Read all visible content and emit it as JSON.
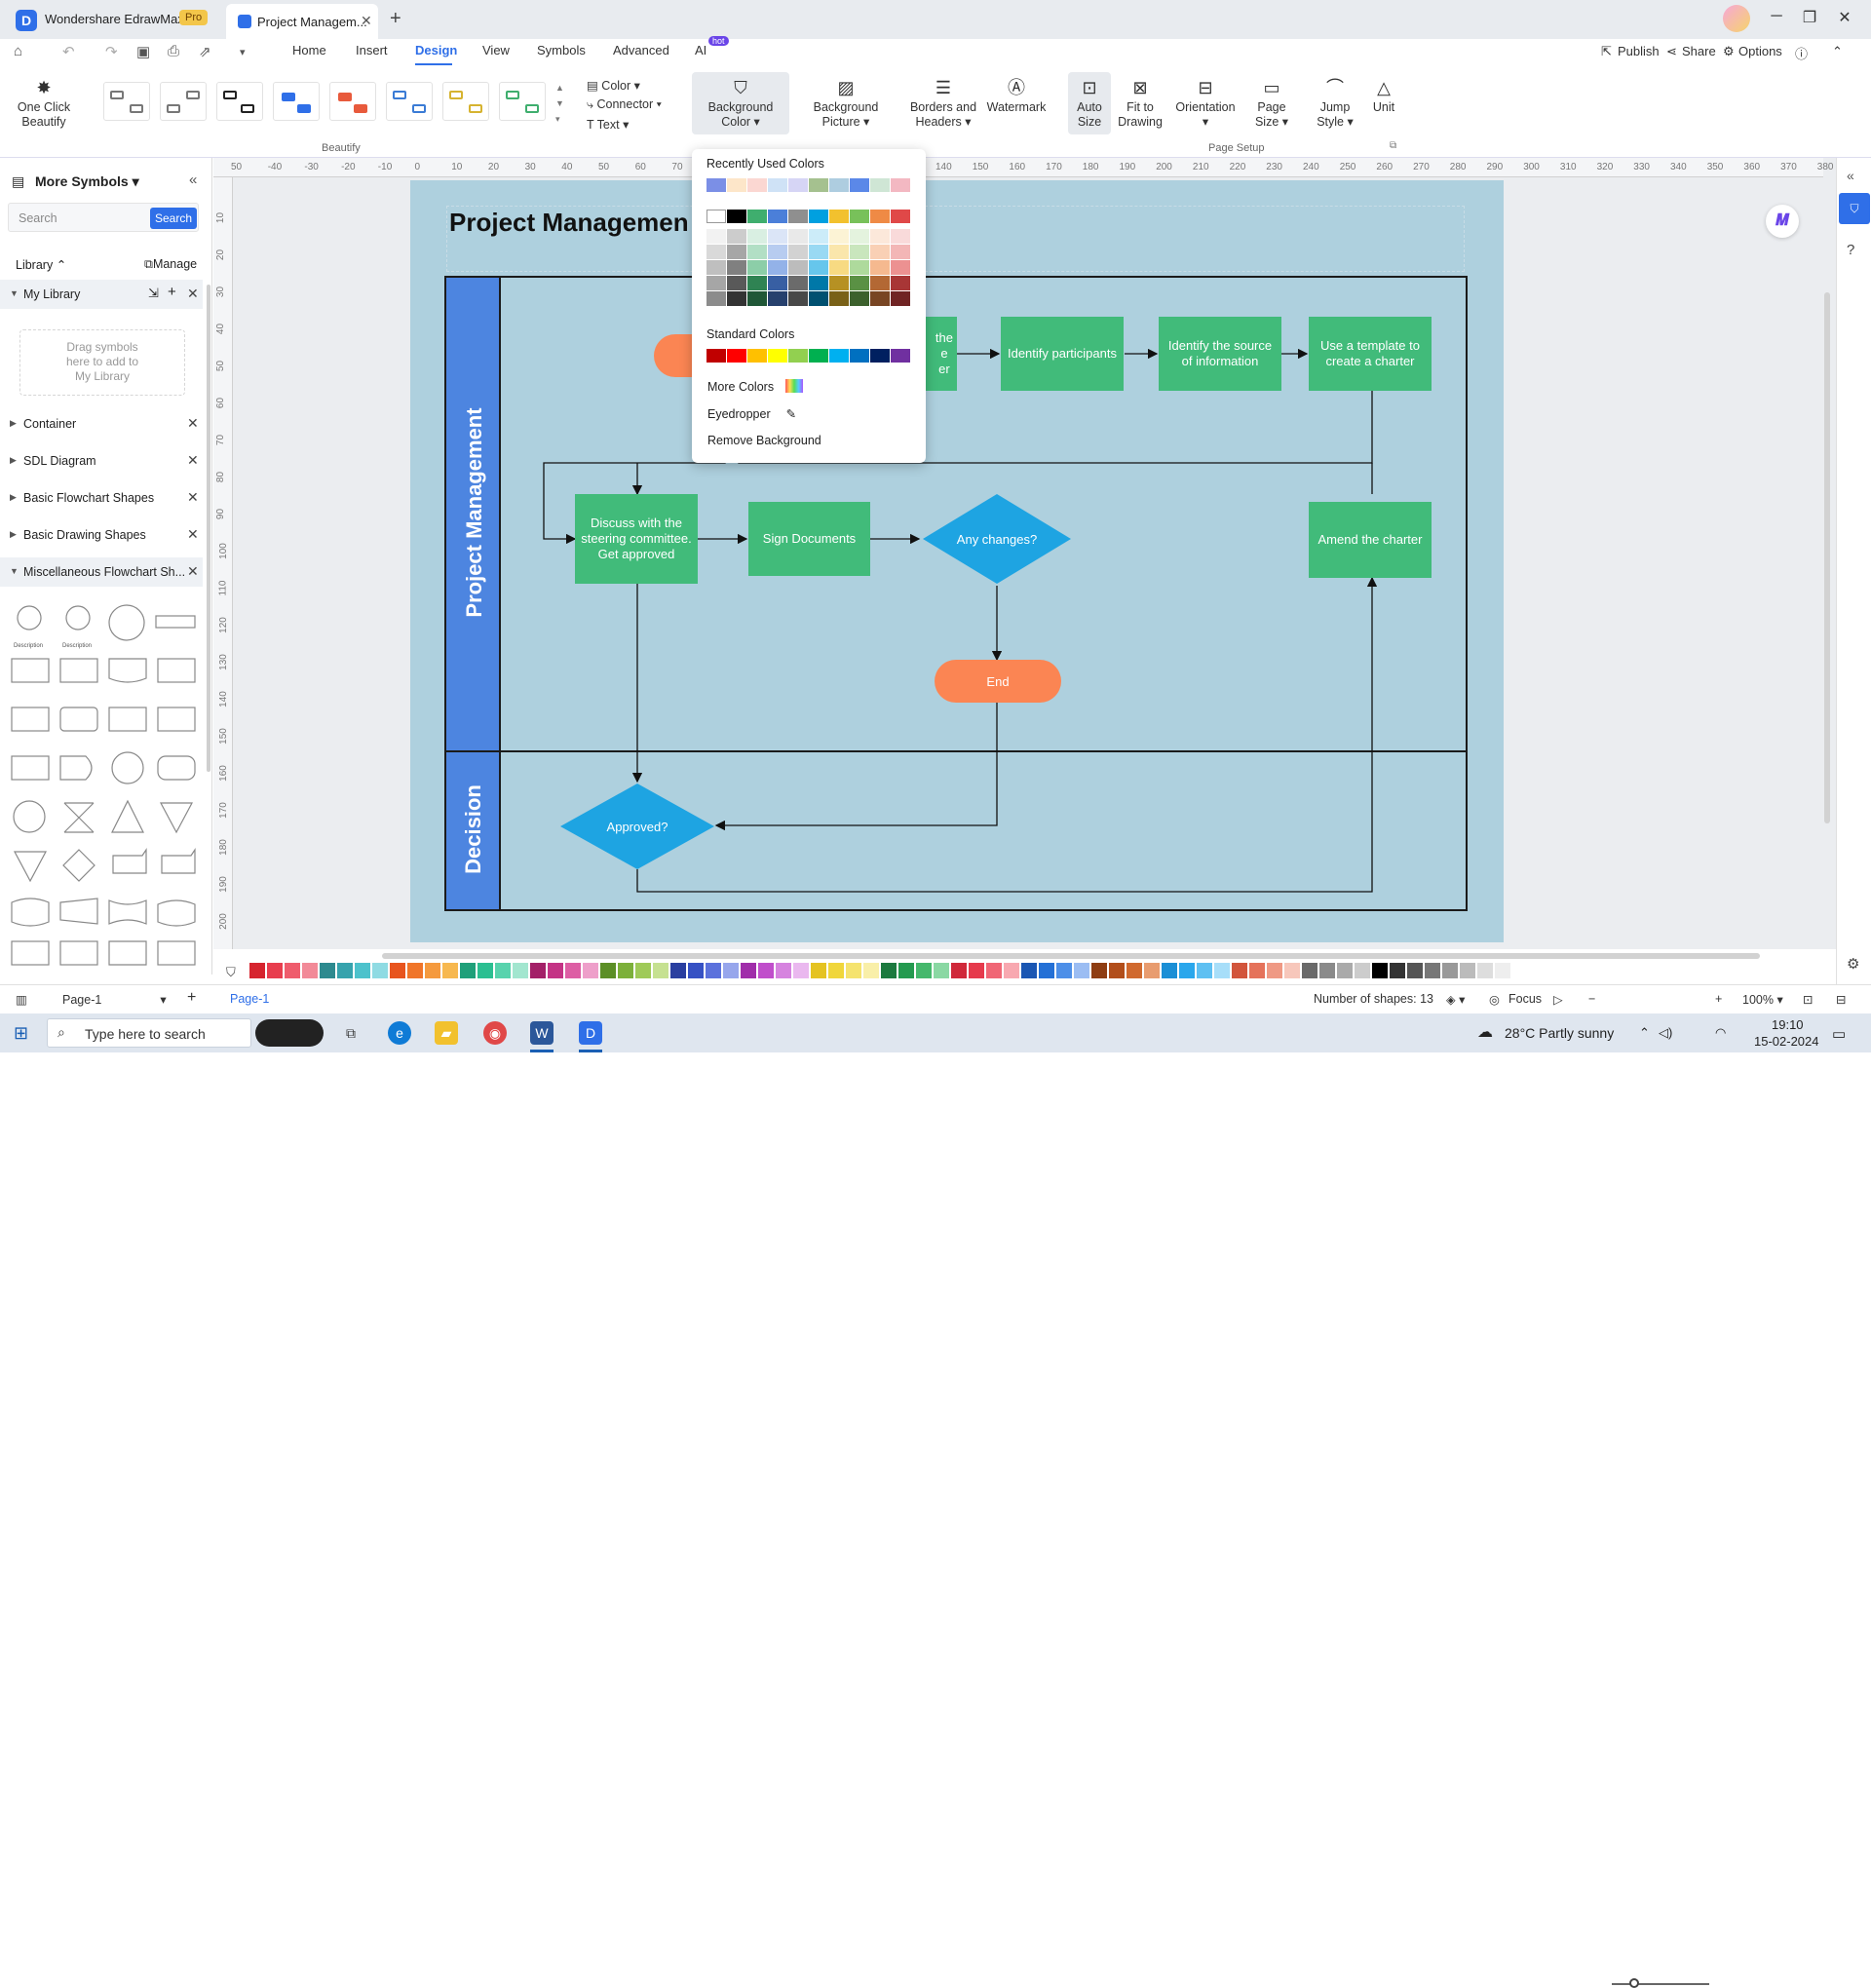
{
  "titlebar": {
    "app_name": "Wondershare EdrawMax",
    "badge": "Pro",
    "tab_title": "Project Managem...",
    "close": "✕",
    "new_tab": "+",
    "minimize": "─",
    "maximize": "❐",
    "close_window": "✕"
  },
  "menu": {
    "items": [
      "Home",
      "Insert",
      "Design",
      "View",
      "Symbols",
      "Advanced",
      "AI"
    ],
    "active": "Design",
    "hot": "hot",
    "publish": "Publish",
    "share": "Share",
    "options": "Options"
  },
  "ribbon": {
    "one_click": "One Click\nBeautify",
    "color": "Color",
    "connector": "Connector",
    "text": "Text",
    "beautify_label": "Beautify",
    "buttons": [
      {
        "label": "Background\nColor",
        "icon": "paint-bucket-icon"
      },
      {
        "label": "Background\nPicture",
        "icon": "picture-icon"
      },
      {
        "label": "Borders and\nHeaders",
        "icon": "borders-icon"
      },
      {
        "label": "Watermark",
        "icon": "watermark-icon"
      },
      {
        "label": "Auto\nSize",
        "icon": "auto-size-icon"
      },
      {
        "label": "Fit to\nDrawing",
        "icon": "fit-icon"
      },
      {
        "label": "Orientation",
        "icon": "orientation-icon"
      },
      {
        "label": "Page\nSize",
        "icon": "page-size-icon"
      },
      {
        "label": "Jump\nStyle",
        "icon": "jump-style-icon"
      },
      {
        "label": "Unit",
        "icon": "unit-icon"
      }
    ],
    "page_setup_label": "Page Setup"
  },
  "sidebar": {
    "title": "More Symbols",
    "search_placeholder": "Search",
    "search_button": "Search",
    "library": "Library",
    "manage": "Manage",
    "my_library": "My Library",
    "drag_hint": "Drag symbols\nhere to add to\nMy Library",
    "categories": [
      "Container",
      "SDL Diagram",
      "Basic Flowchart Shapes",
      "Basic Drawing Shapes",
      "Miscellaneous Flowchart Sh..."
    ],
    "shape_captions": [
      "Description",
      "Description"
    ]
  },
  "ruler": {
    "h": [
      "50",
      "-40",
      "-30",
      "-20",
      "-10",
      "0",
      "10",
      "20",
      "30",
      "40",
      "50",
      "60",
      "70",
      "140",
      "150",
      "160",
      "170",
      "180",
      "190",
      "200",
      "210",
      "220",
      "230",
      "240",
      "250",
      "260",
      "270",
      "280",
      "290",
      "300",
      "310",
      "320",
      "330",
      "340",
      "350",
      "360",
      "370",
      "380"
    ],
    "v": [
      "10",
      "20",
      "30",
      "40",
      "50",
      "60",
      "70",
      "80",
      "90",
      "100",
      "110",
      "120",
      "130",
      "140",
      "150",
      "160",
      "170",
      "180",
      "190",
      "200"
    ]
  },
  "diagram": {
    "title": "Project Managemen",
    "lane1": "Project Management",
    "lane2": "Decision",
    "nodes": {
      "partial": "the\ne\ner",
      "participants": "Identify participants",
      "source": "Identify the source\nof information",
      "template": "Use a template to\ncreate a charter",
      "discuss": "Discuss with the\nsteering committee.\nGet approved",
      "sign": "Sign Documents",
      "changes": "Any changes?",
      "amend": "Amend the charter",
      "end": "End",
      "approved": "Approved?"
    }
  },
  "bgpanel": {
    "recent_label": "Recently Used Colors",
    "recent": [
      "#7b8fe6",
      "#fde6c9",
      "#fbd7d2",
      "#cfe2f6",
      "#d6d5f5",
      "#a5c18f",
      "#aecde0",
      "#5b88e8",
      "#cfe6d5",
      "#f3b8c2"
    ],
    "theme_top": [
      "#ffffff",
      "#000000",
      "#3fae6e",
      "#4b7fd9",
      "#8f8f8f",
      "#00a0e0",
      "#f2c12e",
      "#78c15a",
      "#ef8a45",
      "#e04848"
    ],
    "standard_label": "Standard Colors",
    "standard": [
      "#c00000",
      "#ff0000",
      "#ffc000",
      "#ffff00",
      "#92d050",
      "#00b050",
      "#00b0f0",
      "#0070c0",
      "#002060",
      "#7030a0"
    ],
    "more_colors": "More Colors",
    "eyedropper": "Eyedropper",
    "remove_bg": "Remove Background"
  },
  "palette": [
    "#d6242e",
    "#e83d4e",
    "#ef5c6c",
    "#f28a98",
    "#2d8a8f",
    "#36a3ad",
    "#4dc2cc",
    "#8fdbe3",
    "#e8541d",
    "#f07529",
    "#f59a3e",
    "#f7b84f",
    "#1fa07a",
    "#2bbf91",
    "#58d3ad",
    "#a2e6cf",
    "#a32068",
    "#c43385",
    "#dd5ea4",
    "#ee9fca",
    "#5c8f26",
    "#7cb03a",
    "#9fca58",
    "#c6e191",
    "#2a3fa0",
    "#3651c4",
    "#5b71dc",
    "#97a6ec",
    "#a02daa",
    "#c04ecb",
    "#d683df",
    "#eab8ef",
    "#e5c321",
    "#f0d63b",
    "#f5e36e",
    "#f9efa8",
    "#1c7a3f",
    "#249a4f",
    "#45b86c",
    "#8ad8a3",
    "#d0283a",
    "#e63a4c",
    "#f06675",
    "#f8a8b0",
    "#1a56b3",
    "#2470d6",
    "#4d8fe8",
    "#9bbdf3",
    "#8f3d12",
    "#b24e1a",
    "#d0692e",
    "#e89c6f",
    "#1a8fd6",
    "#2aa7ec",
    "#5ec0f2",
    "#a7def9",
    "#d2553c",
    "#e5725a",
    "#ef9984",
    "#f7c7bb",
    "#6a6a6a",
    "#8a8a8a",
    "#aaaaaa",
    "#cccccc",
    "#000000",
    "#333333",
    "#555555",
    "#777777",
    "#999999",
    "#bbbbbb",
    "#dddddd",
    "#eeeeee"
  ],
  "status": {
    "page_tab": "Page-1",
    "page_tab2": "Page-1",
    "add": "+",
    "shapes": "Number of shapes: 13",
    "focus": "Focus",
    "zoom": "100%"
  },
  "taskbar": {
    "search": "Type here to search",
    "weather": "28°C  Partly sunny",
    "time": "19:10",
    "date": "15-02-2024"
  }
}
